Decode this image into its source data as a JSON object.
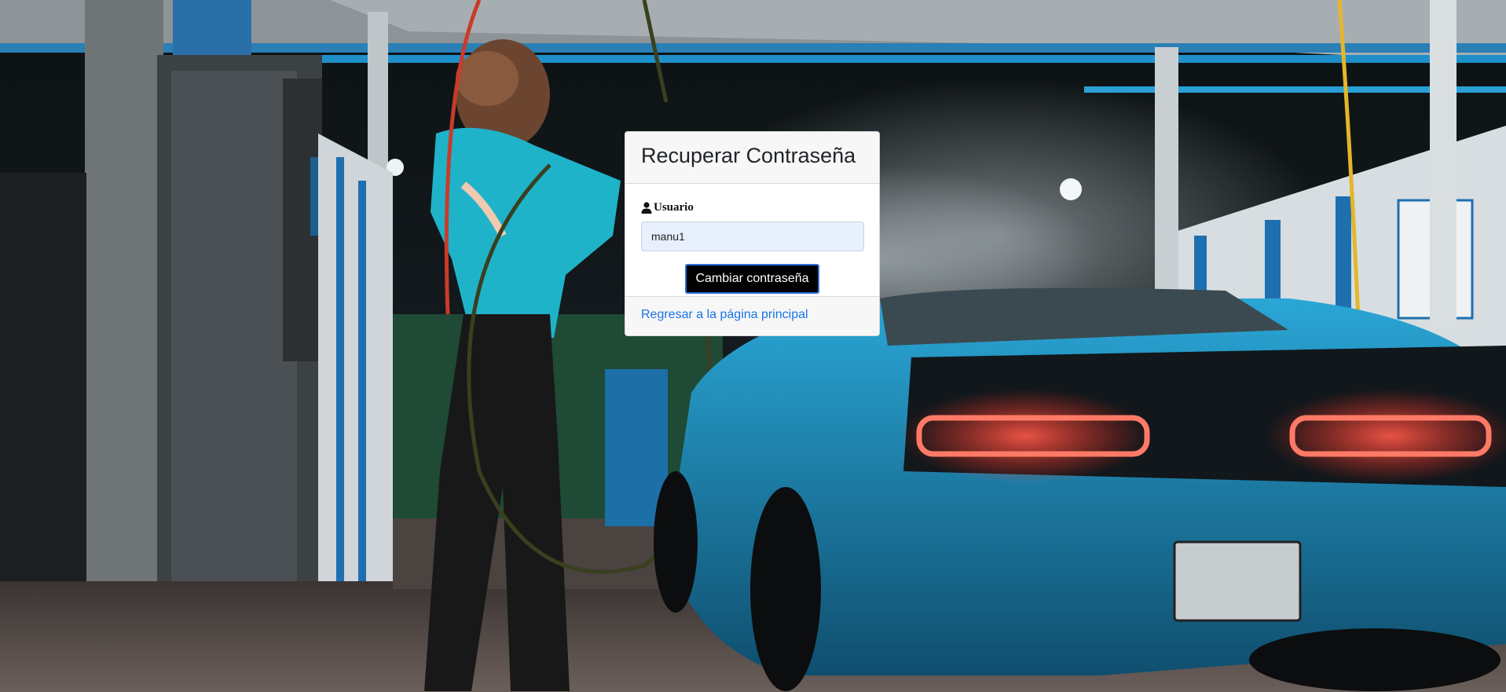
{
  "colors": {
    "accent_link": "#1a73e8",
    "button_bg": "#000000",
    "button_border": "#2b6fd6",
    "input_bg": "#e8f0fe"
  },
  "background": {
    "description_icon": "car-wash-background-photo"
  },
  "recover": {
    "title": "Recuperar Contraseña",
    "user_label": "Usuario",
    "user_icon": "user-icon",
    "user_value": "manu1",
    "submit_label": "Cambiar contraseña",
    "back_link": "Regresar a la página principal"
  }
}
